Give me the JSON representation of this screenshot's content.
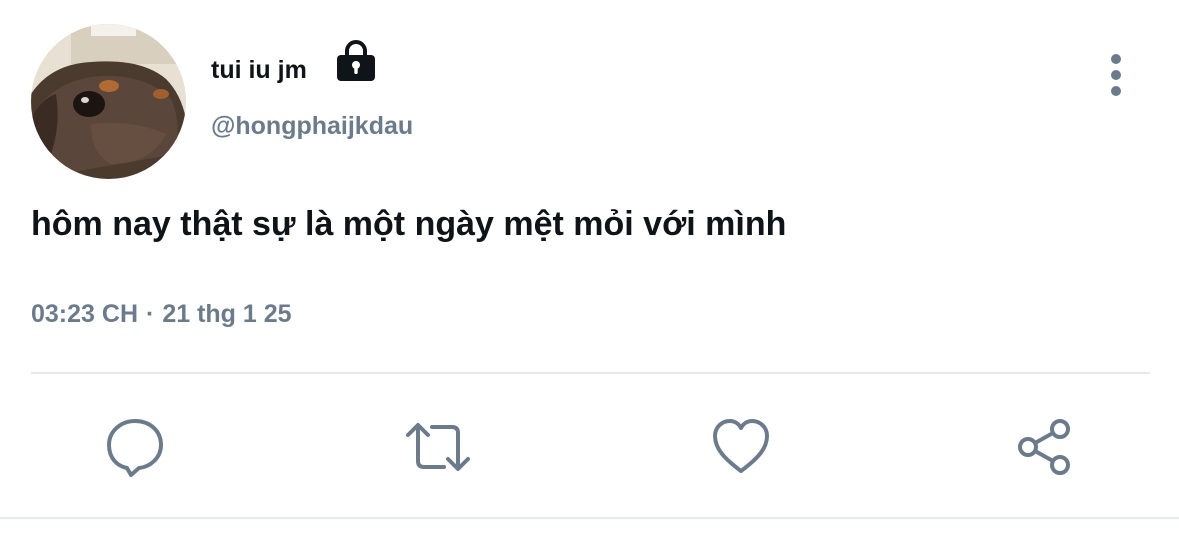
{
  "tweet": {
    "author": {
      "display_name": "tui iu jm",
      "handle": "@hongphaijkdau",
      "avatar_icon": "avatar-dog-photo",
      "protected_icon": "lock-icon"
    },
    "text": "hôm nay thật sự là một ngày mệt mỏi với mình",
    "time": "03:23 CH",
    "separator": "·",
    "date": "21 thg 1 25"
  },
  "actions": [
    {
      "name": "reply",
      "icon": "speech-bubble-icon"
    },
    {
      "name": "retweet",
      "icon": "retweet-arrows-icon"
    },
    {
      "name": "like",
      "icon": "heart-icon"
    },
    {
      "name": "share",
      "icon": "share-nodes-icon"
    }
  ],
  "menu": {
    "icon": "vertical-ellipsis-icon"
  },
  "colors": {
    "primary_text": "#0f1419",
    "secondary_text": "#6b7b8c",
    "icon": "#6b7b8c",
    "divider": "#e6eaee",
    "background": "#ffffff"
  }
}
